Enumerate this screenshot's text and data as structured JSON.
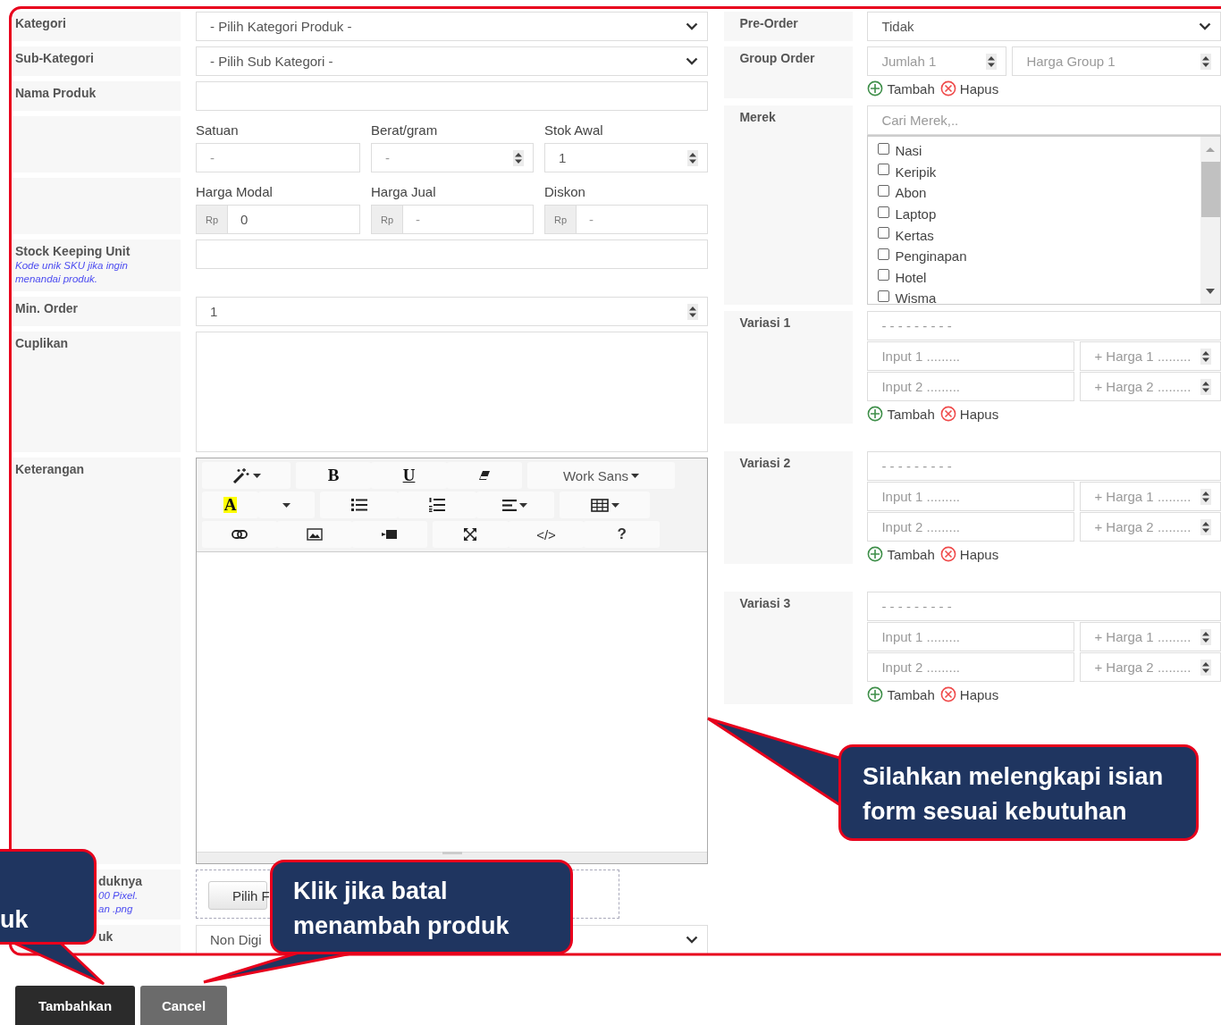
{
  "form_left": [
    {
      "kind": "select",
      "label": "Kategori",
      "value": "- Pilih Kategori Produk -"
    },
    {
      "kind": "select",
      "label": "Sub-Kategori",
      "value": "- Pilih Sub Kategori -"
    },
    {
      "kind": "text",
      "label": "Nama Produk"
    },
    {
      "kind": "triple",
      "fields": [
        {
          "heading": "Satuan",
          "placeholder": "-",
          "spinner": false
        },
        {
          "heading": "Berat/gram",
          "placeholder": "-",
          "spinner": true
        },
        {
          "heading": "Stok Awal",
          "value": "1",
          "spinner": true
        }
      ]
    },
    {
      "kind": "triple",
      "fields": [
        {
          "heading": "Harga Modal",
          "addon": "Rp",
          "value": "0",
          "spinner": false
        },
        {
          "heading": "Harga Jual",
          "addon": "Rp",
          "placeholder": "-",
          "spinner": false
        },
        {
          "heading": "Diskon",
          "addon": "Rp",
          "placeholder": "-",
          "spinner": false
        }
      ]
    },
    {
      "kind": "text",
      "label": "Stock Keeping Unit",
      "hint": [
        "Kode unik SKU jika ingin",
        "menandai produk."
      ]
    },
    {
      "kind": "number",
      "label": "Min. Order",
      "value": "1"
    },
    {
      "kind": "textarea",
      "label": "Cuplikan"
    },
    {
      "kind": "editor",
      "label": "Keterangan",
      "toolbar": [
        {
          "groups": [
            {
              "buttons": [
                {
                  "kind": "magic",
                  "caret": true
                }
              ]
            },
            {
              "buttons": [
                {
                  "kind": "bold",
                  "label": "B",
                  "caret": false
                },
                {
                  "kind": "underline",
                  "label": "U",
                  "caret": false
                },
                {
                  "kind": "eraser",
                  "caret": false
                }
              ]
            },
            {
              "buttons": [
                {
                  "kind": "font",
                  "label": "Work Sans",
                  "caret": true
                }
              ]
            }
          ]
        },
        {
          "groups": [
            {
              "buttons": [
                {
                  "kind": "color",
                  "label": "A",
                  "caret": false
                },
                {
                  "kind": "caret",
                  "caret": false
                }
              ]
            },
            {
              "buttons": [
                {
                  "kind": "ul",
                  "caret": false
                },
                {
                  "kind": "ol",
                  "caret": false
                },
                {
                  "kind": "align",
                  "caret": true
                }
              ]
            },
            {
              "buttons": [
                {
                  "kind": "table",
                  "caret": true
                }
              ]
            }
          ]
        },
        {
          "groups": [
            {
              "buttons": [
                {
                  "kind": "link",
                  "caret": false
                },
                {
                  "kind": "picture",
                  "caret": false
                },
                {
                  "kind": "video",
                  "caret": false
                }
              ]
            },
            {
              "buttons": [
                {
                  "kind": "fullscreen",
                  "caret": false
                },
                {
                  "kind": "code",
                  "label": "</>",
                  "caret": false
                },
                {
                  "kind": "help",
                  "label": "?",
                  "caret": false
                }
              ]
            }
          ]
        }
      ]
    },
    {
      "kind": "upload",
      "label": "duknya",
      "hint": [
        "00 Pixel.",
        "an .png"
      ],
      "button": "Pilih F"
    },
    {
      "kind": "select",
      "label": "uk",
      "value": "Non Digi"
    }
  ],
  "form_right": [
    {
      "kind": "select",
      "label": "Pre-Order",
      "value": "Tidak"
    },
    {
      "kind": "group",
      "label": "Group Order",
      "fields": [
        {
          "placeholder": "Jumlah 1"
        },
        {
          "placeholder": "Harga Group 1"
        }
      ],
      "add": "Tambah",
      "remove": "Hapus"
    },
    {
      "kind": "brands",
      "label": "Merek",
      "placeholder": "Cari Merek,..",
      "items": [
        {
          "label": "Nasi",
          "checked": false
        },
        {
          "label": "Keripik",
          "checked": false
        },
        {
          "label": "Abon",
          "checked": false
        },
        {
          "label": "Laptop",
          "checked": false
        },
        {
          "label": "Kertas",
          "checked": false
        },
        {
          "label": "Penginapan",
          "checked": false
        },
        {
          "label": "Hotel",
          "checked": false
        },
        {
          "label": "Wisma",
          "checked": false
        }
      ]
    },
    {
      "kind": "variant",
      "label": "Variasi 1",
      "placeholder": "- - - - - - - - -",
      "rows": [
        {
          "input": "Input 1 .........",
          "price": "+ Harga 1 ........."
        },
        {
          "input": "Input 2 .........",
          "price": "+ Harga 2 ........."
        }
      ],
      "add": "Tambah",
      "remove": "Hapus"
    },
    {
      "kind": "variant",
      "label": "Variasi 2",
      "placeholder": "- - - - - - - - -",
      "rows": [
        {
          "input": "Input 1 .........",
          "price": "+ Harga 1 ........."
        },
        {
          "input": "Input 2 .........",
          "price": "+ Harga 2 ........."
        }
      ],
      "add": "Tambah",
      "remove": "Hapus"
    },
    {
      "kind": "variant",
      "label": "Variasi 3",
      "placeholder": "- - - - - - - - -",
      "rows": [
        {
          "input": "Input 1 .........",
          "price": "+ Harga 1 ........."
        },
        {
          "input": "Input 2 .........",
          "price": "+ Harga 2 ........."
        }
      ],
      "add": "Tambah",
      "remove": "Hapus"
    }
  ],
  "buttons": [
    {
      "kind": "primary",
      "label": "Tambahkan"
    },
    {
      "kind": "secondary",
      "label": "Cancel"
    }
  ],
  "callouts": [
    {
      "lines": [
        "uk"
      ]
    },
    {
      "lines": [
        "Klik jika batal",
        "menambah produk"
      ]
    },
    {
      "lines": [
        "Silahkan melengkapi isian",
        "form sesuai kebutuhan"
      ]
    }
  ]
}
